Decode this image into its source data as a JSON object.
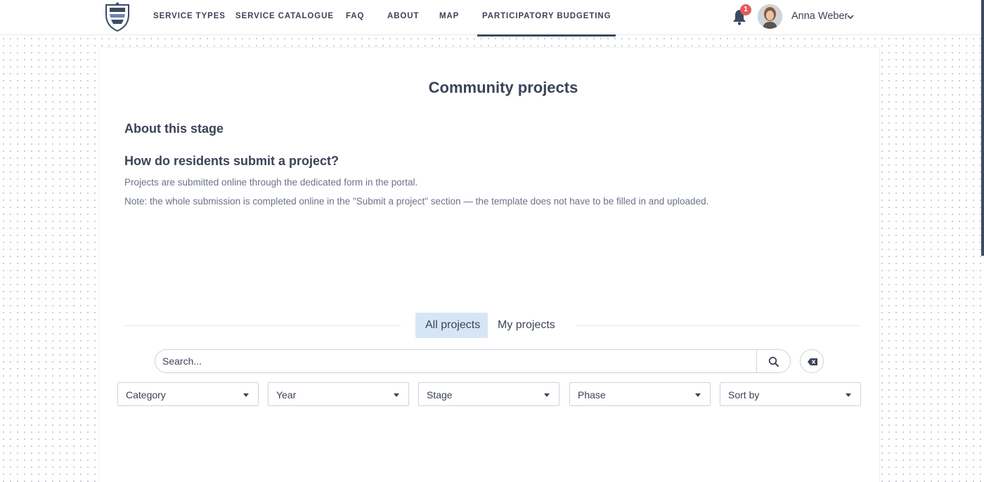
{
  "nav": {
    "items": [
      {
        "label": "SERVICE TYPES"
      },
      {
        "label": "SERVICE CATALOGUE"
      },
      {
        "label": "FAQ"
      },
      {
        "label": "ABOUT"
      },
      {
        "label": "MAP"
      },
      {
        "label": "PARTICIPATORY BUDGETING",
        "active": true
      }
    ],
    "notifications_count": "1",
    "user_name": "Anna Weber"
  },
  "page": {
    "title": "Community projects",
    "about_heading": "About this stage",
    "question_heading": "How do residents submit a project?",
    "paragraph_1": "Projects are submitted online through the dedicated form in the portal.",
    "paragraph_2": "Note: the whole submission is completed online in the \"Submit a project\" section — the template does not have to be filled in and uploaded."
  },
  "tabs": [
    {
      "label": "All projects",
      "active": true
    },
    {
      "label": "My projects",
      "active": false
    }
  ],
  "search": {
    "placeholder": "Search..."
  },
  "filters": [
    {
      "label": "Category"
    },
    {
      "label": "Year"
    },
    {
      "label": "Stage"
    },
    {
      "label": "Phase"
    },
    {
      "label": "Sort by"
    }
  ],
  "colors": {
    "accent": "#3d4a63",
    "active_tab_bg": "#d6e6f7",
    "badge": "#e25a5a"
  },
  "icons": {
    "logo": "coat-of-arms-icon",
    "bell": "bell-icon",
    "chevron": "chevron-down-icon",
    "search": "search-icon",
    "clear": "backspace-icon"
  }
}
